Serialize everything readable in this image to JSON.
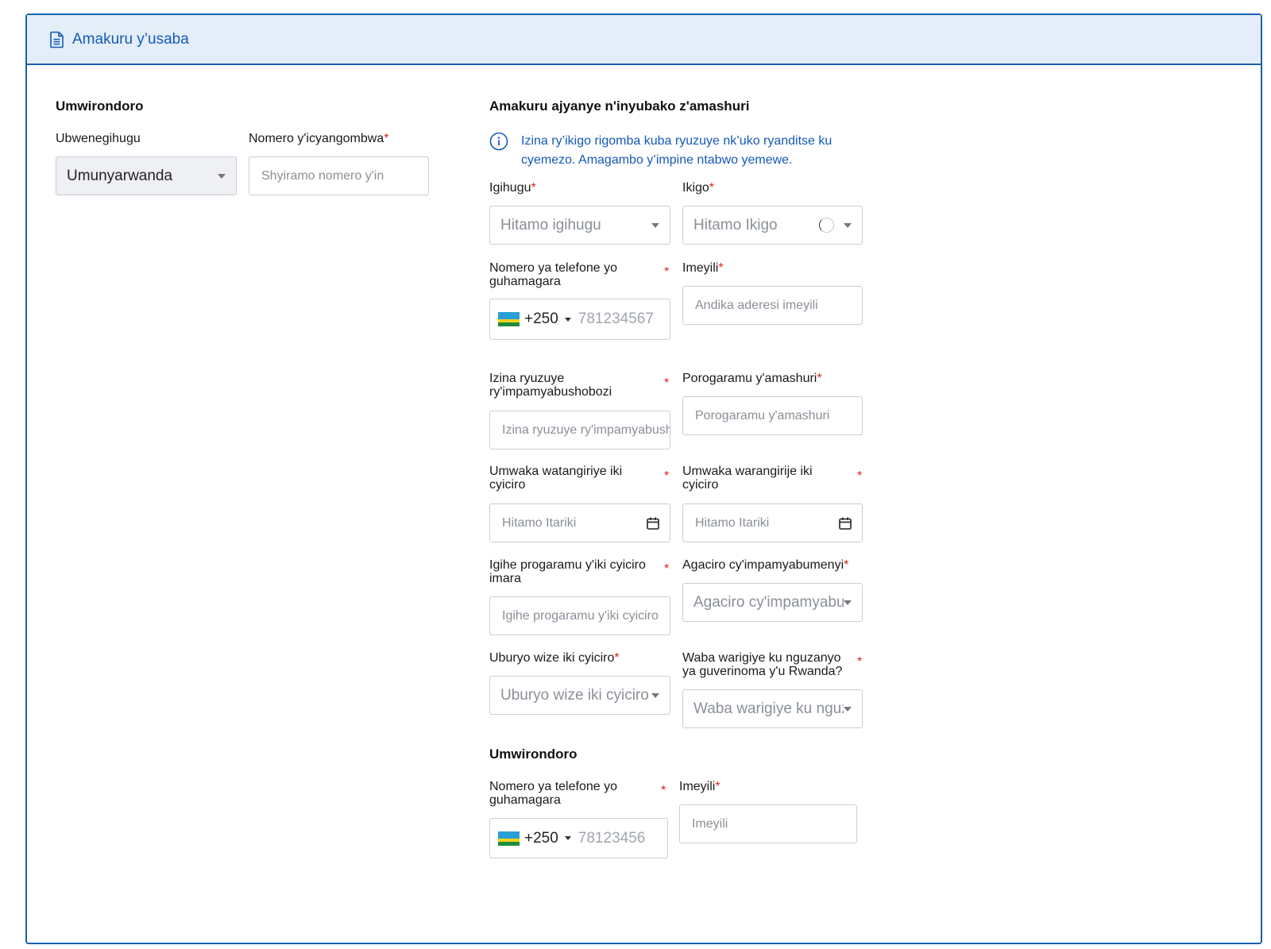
{
  "header": {
    "title": "Amakuru y’usaba",
    "icon": "document-icon"
  },
  "left": {
    "section_title": "Umwirondoro",
    "nationality": {
      "label": "Ubwenegihugu",
      "value": "Umunyarwanda"
    },
    "id_number": {
      "label": "Nomero y'icyangombwa",
      "placeholder": "Shyiramo nomero y'in"
    }
  },
  "right": {
    "section_title": "Amakuru ajyanye n'inyubako z'amashuri",
    "info": "Izina ry’ikigo rigomba kuba ryuzuye nk’uko ryanditse ku cyemezo. Amagambo y’impine ntabwo yemewe.",
    "country": {
      "label": "Igihugu",
      "placeholder": "Hitamo igihugu"
    },
    "institution": {
      "label": "Ikigo",
      "placeholder": "Hitamo Ikigo"
    },
    "phone": {
      "label_1": "Nomero ya telefone yo",
      "label_2": "guhamagara",
      "code": "+250",
      "placeholder": "781234567"
    },
    "email": {
      "label": "Imeyili",
      "placeholder": "Andika aderesi imeyili"
    },
    "qualification_name": {
      "label_1": "Izina ryuzuye",
      "label_2": "ry'impamyabushobozi",
      "placeholder": "Izina ryuzuye ry'impamyabushobozi"
    },
    "program": {
      "label": "Porogaramu y'amashuri",
      "placeholder": "Porogaramu y'amashuri"
    },
    "start_year": {
      "label_1": "Umwaka watangiriye iki",
      "label_2": "cyiciro",
      "placeholder": "Hitamo Itariki"
    },
    "end_year": {
      "label_1": "Umwaka warangirije iki",
      "label_2": "cyiciro",
      "placeholder": "Hitamo Itariki"
    },
    "duration": {
      "label_1": "Igihe progaramu y'iki cyiciro",
      "label_2": "imara",
      "placeholder": "Igihe progaramu y'iki cyiciro"
    },
    "grade": {
      "label": "Agaciro cy'impamyabumenyi",
      "placeholder": "Agaciro cy'impamyabumenyi"
    },
    "study_mode": {
      "label": "Uburyo wize iki cyiciro",
      "placeholder": "Uburyo wize iki cyiciro"
    },
    "loan": {
      "label_1": "Waba warigiye ku nguzanyo",
      "label_2": "ya guverinoma y'u Rwanda?",
      "placeholder": "Waba warigiye ku nguzanyo"
    }
  },
  "contact": {
    "section_title": "Umwirondoro",
    "phone": {
      "label_1": "Nomero ya telefone yo",
      "label_2": "guhamagara",
      "code": "+250",
      "placeholder": "78123456"
    },
    "email": {
      "label": "Imeyili",
      "placeholder": "Imeyili"
    }
  },
  "required_mark": "*"
}
